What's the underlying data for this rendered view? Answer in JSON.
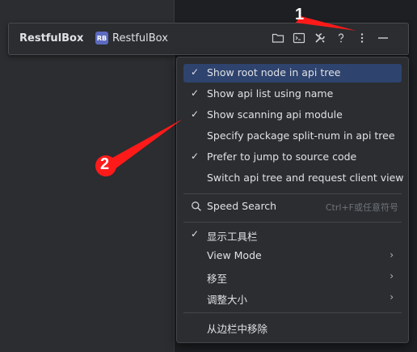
{
  "toolwindow": {
    "title": "RestfulBox",
    "tab_badge": "RB",
    "tab_label": "RestfulBox",
    "icons": [
      "folder-icon",
      "terminal-window-icon",
      "tools-icon",
      "help-icon",
      "more-options-icon",
      "minimize-icon"
    ]
  },
  "menu": {
    "items": [
      {
        "checked": true,
        "label": "Show root node in api tree"
      },
      {
        "checked": true,
        "label": "Show api list using name"
      },
      {
        "checked": true,
        "label": "Show scanning api module"
      },
      {
        "checked": false,
        "label": "Specify package split-num in api tree"
      },
      {
        "checked": true,
        "label": "Prefer to jump to source code"
      },
      {
        "checked": false,
        "label": "Switch api tree and request client view"
      }
    ],
    "search": {
      "label": "Speed Search",
      "shortcut": "Ctrl+F或任意符号"
    },
    "view_items": [
      {
        "checked": true,
        "label": "显示工具栏"
      },
      {
        "checked": false,
        "label": "View Mode",
        "submenu": true
      },
      {
        "checked": false,
        "label": "移至",
        "submenu": true
      },
      {
        "checked": false,
        "label": "调整大小",
        "submenu": true
      }
    ],
    "remove_label": "从边栏中移除"
  },
  "annotations": {
    "one": "1",
    "two": "2",
    "color": "#ff1a1a"
  },
  "colors": {
    "accent_selection": "#2e436e",
    "background": "#2b2d30"
  }
}
